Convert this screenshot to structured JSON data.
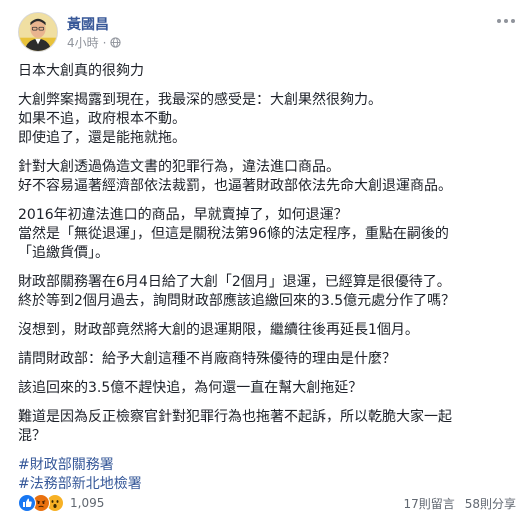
{
  "post": {
    "author": "黃國昌",
    "time": "4小時",
    "lines": [
      "日本大創真的很夠力",
      "",
      "大創弊案揭露到現在，我最深的感受是：大創果然很夠力。",
      "如果不追，政府根本不動。",
      "即使追了，還是能拖就拖。",
      "",
      "針對大創透過偽造文書的犯罪行為，違法進口商品。",
      "好不容易逼著經濟部依法裁罰，也逼著財政部依法先命大創退運商品。",
      "",
      "2016年初違法進口的商品，早就賣掉了，如何退運？",
      "當然是「無從退運」，但這是關稅法第96條的法定程序，重點在嗣後的",
      "「追繳貨價」。",
      "",
      "財政部關務署在6月4日給了大創「2個月」退運，已經算是很優待了。",
      "終於等到2個月過去，詢問財政部應該追繳回來的3.5億元處分作了嗎？",
      "",
      "沒想到，財政部竟然將大創的退運期限，繼續往後再延長1個月。",
      "",
      "請問財政部：給予大創這種不肖廠商特殊優待的理由是什麼？",
      "",
      "該追回來的3.5億不趕快追，為何還一直在幫大創拖延？",
      "",
      "難道是因為反正檢察官針對犯罪行為也拖著不起訴，所以乾脆大家一起",
      "混？"
    ],
    "hashtags": [
      "#財政部關務署",
      "#法務部新北地檢署"
    ]
  },
  "footer": {
    "reaction_count": "1,095",
    "comments": "17則留言",
    "shares": "58則分享"
  },
  "icons": {
    "privacy": "globe-icon",
    "menu": "more-options-icon",
    "reactions": [
      "like-icon",
      "angry-icon",
      "wow-icon"
    ]
  },
  "colors": {
    "author": "#385898",
    "hashtag": "#365899",
    "meta": "#90949c",
    "like": "#1877f2",
    "angry": "#e9710f",
    "wow": "#f7b125"
  }
}
